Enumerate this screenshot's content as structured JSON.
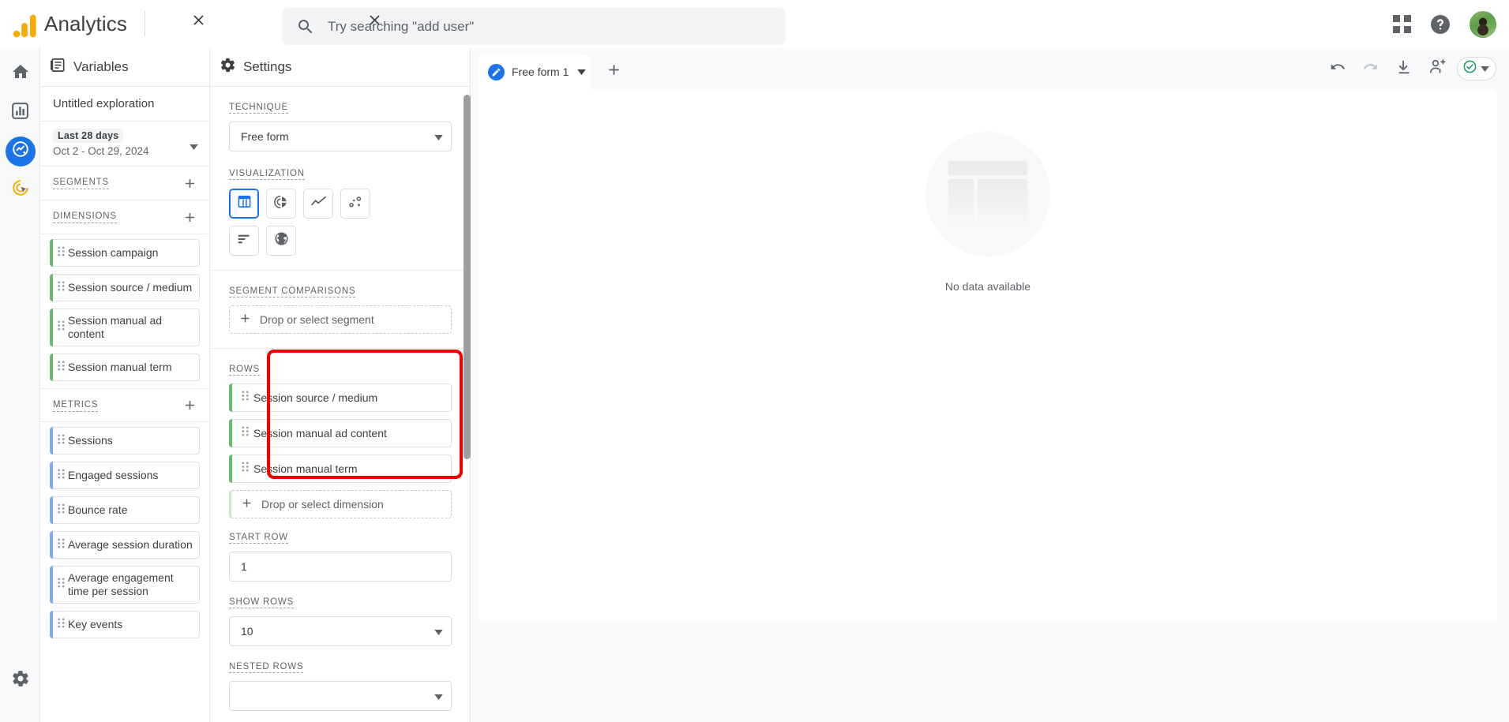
{
  "header": {
    "brand": "Analytics",
    "logo_icon": "ga-logo-icon",
    "search": {
      "placeholder": "Try searching \"add user\"",
      "value": "",
      "icon": "search-icon"
    },
    "apps_icon": "apps-grid-icon",
    "help_icon": "help-circle-icon",
    "avatar_icon": "user-avatar"
  },
  "rail": {
    "items": [
      {
        "name": "home",
        "icon": "home-icon",
        "selected": false
      },
      {
        "name": "reports",
        "icon": "bar-chart-icon",
        "selected": false
      },
      {
        "name": "explore",
        "icon": "explore-icon",
        "selected": true
      },
      {
        "name": "advertising",
        "icon": "advertising-target-icon",
        "selected": false
      }
    ],
    "settings_icon": "gear-icon"
  },
  "variables": {
    "title": "Variables",
    "close_icon": "close-icon",
    "panel_icon": "variables-panel-icon",
    "exploration_name": "Untitled exploration",
    "date_range": {
      "chip": "Last 28 days",
      "range": "Oct 2 - Oct 29, 2024",
      "caret_icon": "chevron-down-icon"
    },
    "segments": {
      "label": "SEGMENTS",
      "add_icon": "plus-icon",
      "items": []
    },
    "dimensions": {
      "label": "DIMENSIONS",
      "add_icon": "plus-icon",
      "items": [
        {
          "label": "Session campaign"
        },
        {
          "label": "Session source / medium"
        },
        {
          "label": "Session manual ad content"
        },
        {
          "label": "Session manual term"
        }
      ]
    },
    "metrics": {
      "label": "METRICS",
      "add_icon": "plus-icon",
      "items": [
        {
          "label": "Sessions"
        },
        {
          "label": "Engaged sessions"
        },
        {
          "label": "Bounce rate"
        },
        {
          "label": "Average session duration"
        },
        {
          "label": "Average engagement time per session"
        },
        {
          "label": "Key events"
        }
      ]
    }
  },
  "settings": {
    "title": "Settings",
    "close_icon": "close-icon",
    "panel_icon": "gear-icon",
    "technique": {
      "label": "TECHNIQUE",
      "value": "Free form",
      "caret_icon": "chevron-down-icon"
    },
    "visualization": {
      "label": "VISUALIZATION",
      "options": [
        {
          "name": "table",
          "icon": "table-icon",
          "selected": true
        },
        {
          "name": "donut",
          "icon": "donut-chart-icon",
          "selected": false
        },
        {
          "name": "line",
          "icon": "line-chart-icon",
          "selected": false
        },
        {
          "name": "scatter",
          "icon": "scatter-plot-icon",
          "selected": false
        },
        {
          "name": "bar",
          "icon": "bar-chart-horizontal-icon",
          "selected": false
        },
        {
          "name": "geo",
          "icon": "globe-icon",
          "selected": false
        }
      ]
    },
    "segment_comparisons": {
      "label": "SEGMENT COMPARISONS",
      "drop_label": "Drop or select segment",
      "add_icon": "plus-icon"
    },
    "rows": {
      "label": "ROWS",
      "items": [
        {
          "label": "Session source / medium"
        },
        {
          "label": "Session manual ad content"
        },
        {
          "label": "Session manual term"
        }
      ],
      "drop_label": "Drop or select dimension",
      "add_icon": "plus-icon",
      "highlighted": true,
      "highlight_color": "#f20000"
    },
    "start_row": {
      "label": "START ROW",
      "value": "1"
    },
    "show_rows": {
      "label": "SHOW ROWS",
      "value": "10",
      "caret_icon": "chevron-down-icon"
    },
    "nested_rows": {
      "label": "NESTED ROWS"
    }
  },
  "canvas": {
    "tab": {
      "label": "Free form 1",
      "icon": "edit-pencil-icon",
      "caret_icon": "chevron-down-icon"
    },
    "add_tab_icon": "plus-icon",
    "toolbar": [
      {
        "name": "undo",
        "icon": "undo-icon",
        "enabled": true
      },
      {
        "name": "redo",
        "icon": "redo-icon",
        "enabled": false
      },
      {
        "name": "download",
        "icon": "download-icon",
        "enabled": true
      },
      {
        "name": "share",
        "icon": "share-person-icon",
        "enabled": true
      }
    ],
    "status": {
      "icon": "check-circle-icon",
      "color": "#0f9d58",
      "caret_icon": "chevron-down-icon"
    },
    "empty_state": {
      "icon": "empty-table-illustration",
      "text": "No data available"
    }
  },
  "colors": {
    "accent": "#1a73e8",
    "dimension": "#67bb6a",
    "metric": "#7baaf7",
    "annotation": "#f20000",
    "text": "#3c4043",
    "muted": "#5f6368"
  }
}
